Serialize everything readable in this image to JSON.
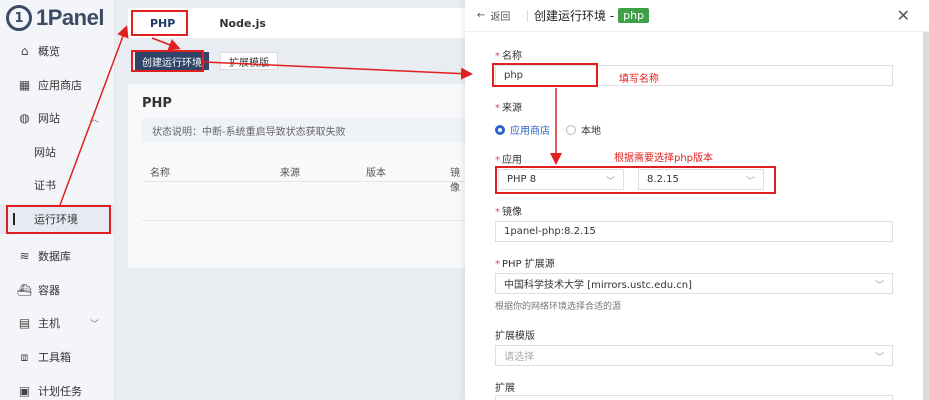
{
  "app": {
    "logo_text": "1Panel"
  },
  "sidebar": {
    "items": [
      {
        "label": "概览",
        "icon": "home-icon"
      },
      {
        "label": "应用商店",
        "icon": "grid-icon"
      },
      {
        "label": "网站",
        "icon": "globe-icon"
      },
      {
        "label": "网站",
        "icon": ""
      },
      {
        "label": "证书",
        "icon": ""
      },
      {
        "label": "运行环境",
        "icon": ""
      },
      {
        "label": "数据库",
        "icon": "database-icon"
      },
      {
        "label": "容器",
        "icon": "container-icon"
      },
      {
        "label": "主机",
        "icon": "host-icon"
      },
      {
        "label": "工具箱",
        "icon": "toolbox-icon"
      },
      {
        "label": "计划任务",
        "icon": "calendar-icon"
      }
    ]
  },
  "main": {
    "tabs": [
      {
        "label": "PHP"
      },
      {
        "label": "Node.js"
      }
    ],
    "create_button": "创建运行环境",
    "ext_button": "扩展模版",
    "panel_title": "PHP",
    "status_note": "状态说明：中断-系统重启导致状态获取失败",
    "columns": [
      "名称",
      "来源",
      "版本",
      "镜像"
    ]
  },
  "drawer": {
    "back_label": "返回",
    "title": "创建运行环境 -",
    "title_tag": "php",
    "name_label": "名称",
    "name_value": "php",
    "source_label": "来源",
    "source_options": [
      "应用商店",
      "本地"
    ],
    "app_label": "应用",
    "app_select": "PHP 8",
    "version_select": "8.2.15",
    "image_label": "镜像",
    "image_value": "1panel-php:8.2.15",
    "ext_source_label": "PHP 扩展源",
    "ext_source_value": "中国科学技术大学 [mirrors.ustc.edu.cn]",
    "ext_source_hint": "根据你的网络环境选择合适的源",
    "ext_template_label": "扩展模版",
    "ext_template_placeholder": "请选择",
    "ext_label": "扩展"
  },
  "annotations": {
    "fill_name": "填写名称",
    "choose_version": "根据需要选择php版本",
    "color": "#e02020"
  }
}
